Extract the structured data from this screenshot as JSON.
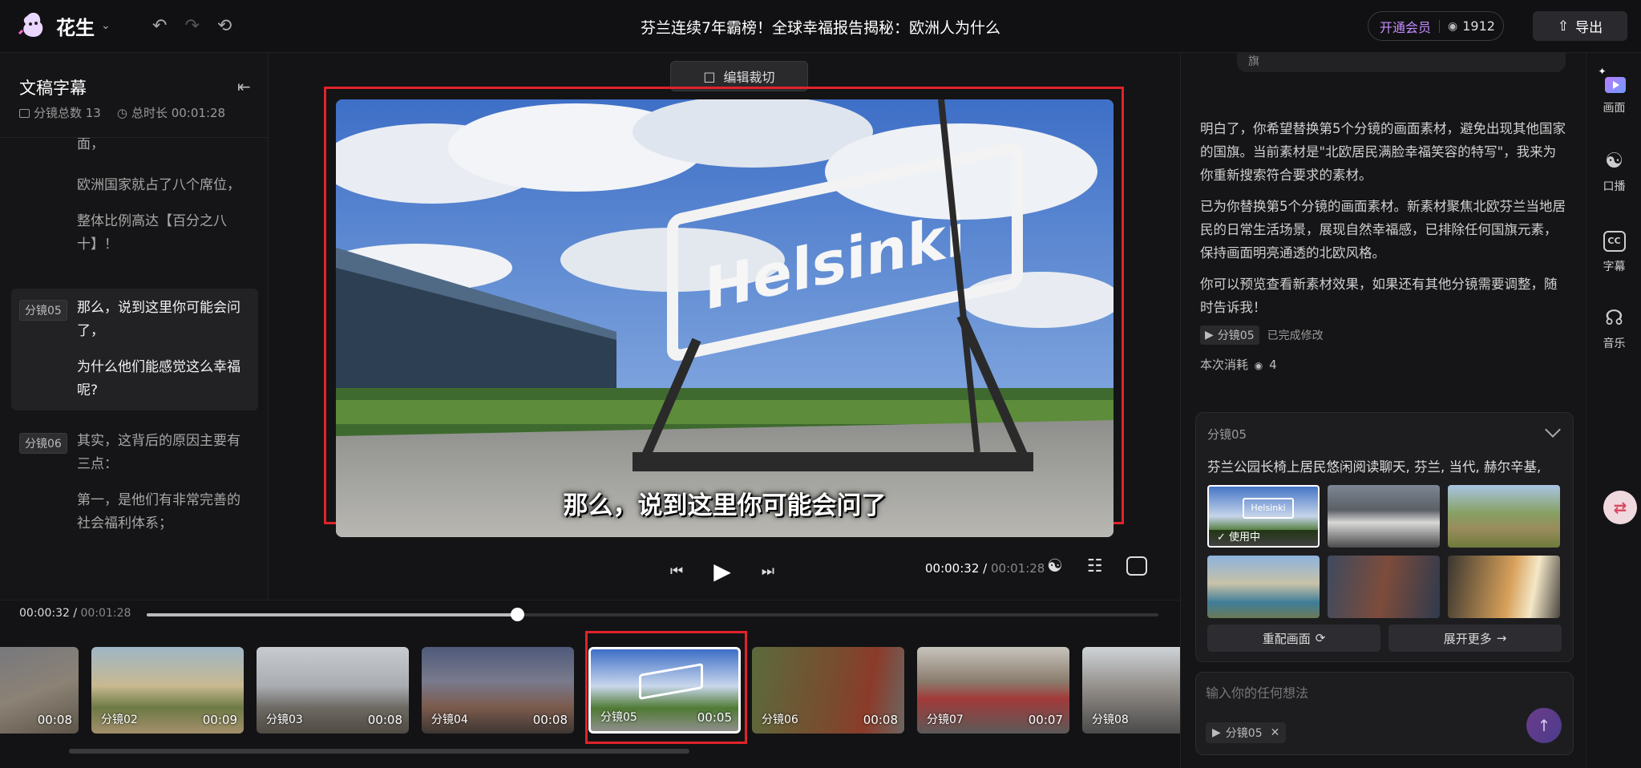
{
  "app": {
    "name": "花生",
    "title": "芬兰连续7年霸榜！全球幸福报告揭秘：欧洲人为什么",
    "vip_label": "开通会员",
    "coins": "1912",
    "export_label": "导出"
  },
  "script_panel": {
    "title": "文稿字幕",
    "shot_count": "分镜总数 13",
    "total_duration": "总时长 00:01:28",
    "segments": [
      {
        "tag": "",
        "lines": [
          "面，",
          "欧洲国家就占了八个席位，",
          "整体比例高达【百分之八十】！"
        ]
      },
      {
        "tag": "分镜05",
        "lines": [
          "那么，说到这里你可能会问了，",
          "为什么他们能感觉这么幸福呢?"
        ]
      },
      {
        "tag": "分镜06",
        "lines": [
          "其实，这背后的原因主要有三点：",
          "第一，是他们有非常完善的社会福利体系；"
        ]
      }
    ]
  },
  "player": {
    "crop_label": "编辑裁切",
    "sign_text": "Helsinki",
    "subtitle": "那么，说到这里你可能会问了",
    "current_time": "00:00:32",
    "total_time": "00:01:28"
  },
  "timeline": {
    "current_time": "00:00:32",
    "total_time": "00:01:28",
    "progress": 0.366,
    "clips": [
      {
        "label": "",
        "duration": "00:08"
      },
      {
        "label": "分镜02",
        "duration": "00:09"
      },
      {
        "label": "分镜03",
        "duration": "00:08"
      },
      {
        "label": "分镜04",
        "duration": "00:08"
      },
      {
        "label": "分镜05",
        "duration": "00:05"
      },
      {
        "label": "分镜06",
        "duration": "00:08"
      },
      {
        "label": "分镜07",
        "duration": "00:07"
      },
      {
        "label": "分镜08",
        "duration": ""
      }
    ]
  },
  "chat": {
    "prev_bubble": "旗",
    "paragraphs": [
      "明白了，你希望替换第5个分镜的画面素材，避免出现其他国家的国旗。当前素材是\"北欧居民满脸幸福笑容的特写\"，我来为你重新搜索符合要求的素材。",
      "已为你替换第5个分镜的画面素材。新素材聚焦北欧芬兰当地居民的日常生活场景，展现自然幸福感，已排除任何国旗元素，保持画面明亮通透的北欧风格。",
      "你可以预览查看新素材效果，如果还有其他分镜需要调整，随时告诉我！"
    ],
    "done_tag": "分镜05",
    "done_text": "已完成修改",
    "cost_label": "本次消耗",
    "cost_value": "4",
    "card": {
      "title": "分镜05",
      "description": "芬兰公园长椅上居民悠闲阅读聊天, 芬兰, 当代, 赫尔辛基,",
      "in_use_label": "使用中",
      "thumb_sign": "Helsinki",
      "rematch_label": "重配画面",
      "expand_label": "展开更多"
    },
    "input_placeholder": "输入你的任何想法",
    "chip_label": "分镜05"
  },
  "rail": {
    "items": [
      "画面",
      "口播",
      "字幕",
      "音乐"
    ]
  }
}
